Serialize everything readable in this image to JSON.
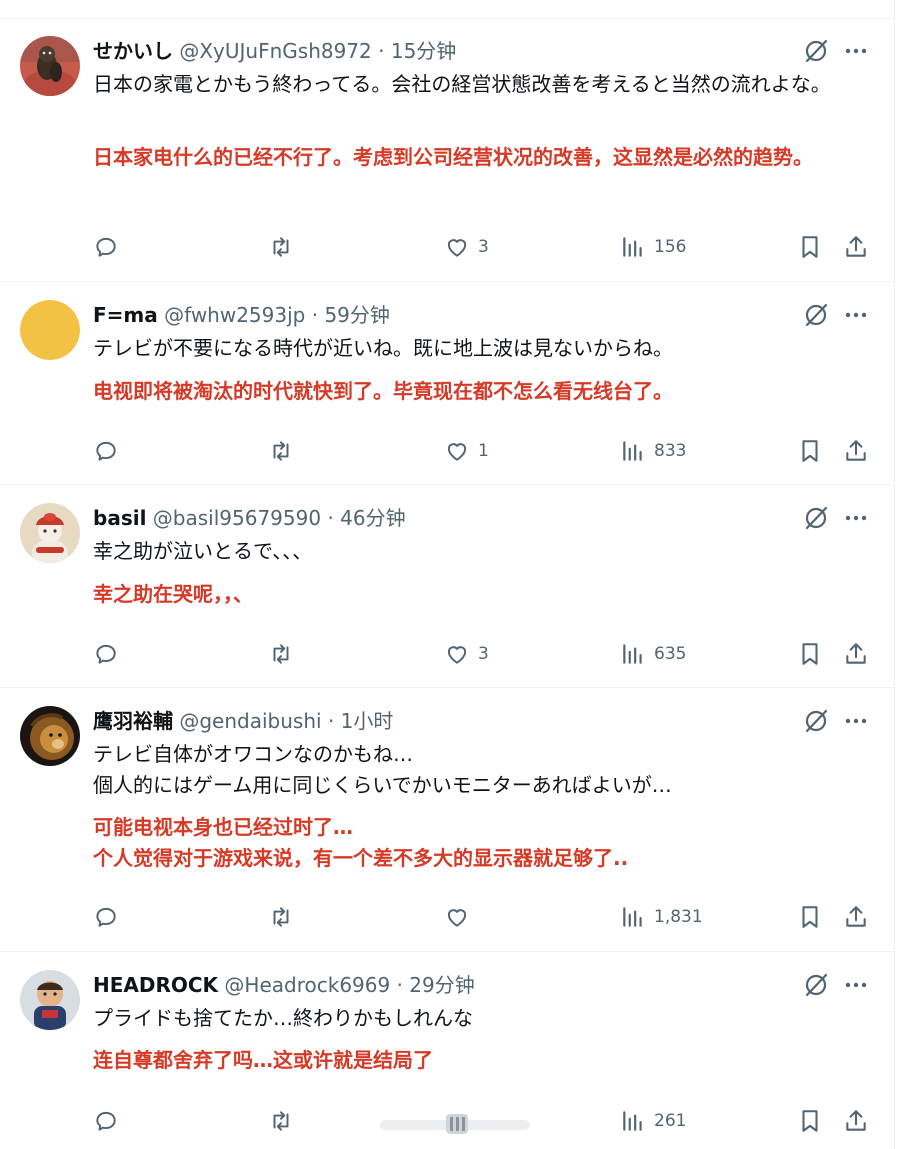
{
  "tweets": [
    {
      "name": "せかいし",
      "handle": "@XyUJuFnGsh8972",
      "time": "15分钟",
      "text_jp": "日本の家電とかもう終わってる。会社の経営状態改善を考えると当然の流れよな。",
      "text_cn": "日本家电什么的已经不行了。考虑到公司经营状况的改善，这显然是必然的趋势。",
      "replies": "",
      "retweets": "",
      "likes": "3",
      "views": "156"
    },
    {
      "name": "F=ma",
      "handle": "@fwhw2593jp",
      "time": "59分钟",
      "text_jp": "テレビが不要になる時代が近いね。既に地上波は見ないからね。",
      "text_cn": "电视即将被淘汰的时代就快到了。毕竟现在都不怎么看无线台了。",
      "replies": "",
      "retweets": "",
      "likes": "1",
      "views": "833"
    },
    {
      "name": "basil",
      "handle": "@basil95679590",
      "time": "46分钟",
      "text_jp": "幸之助が泣いとるで、、、",
      "text_cn": "幸之助在哭呢，，、",
      "replies": "",
      "retweets": "",
      "likes": "3",
      "views": "635"
    },
    {
      "name": "鹰羽裕輔",
      "handle": "@gendaibushi",
      "time": "1小时",
      "text_jp": "テレビ自体がオワコンなのかもね…\n個人的にはゲーム用に同じくらいでかいモニターあればよいが…",
      "text_cn": "可能电视本身也已经过时了…\n个人觉得对于游戏来说，有一个差不多大的显示器就足够了..",
      "replies": "",
      "retweets": "",
      "likes": "",
      "views": "1,831"
    },
    {
      "name": "HEADROCK",
      "handle": "@Headrock6969",
      "time": "29分钟",
      "text_jp": "プライドも捨てたか…終わりかもしれんな",
      "text_cn": "连自尊都舍弃了吗…这或许就是结局了",
      "replies": "",
      "retweets": "",
      "likes": "",
      "views": "261"
    }
  ],
  "header_separator": "·",
  "colors": {
    "translation": "#d63a26",
    "muted": "#536471",
    "text": "#0f1419",
    "divider": "#eff3f4"
  },
  "icons": {
    "reply": "speech-bubble-icon",
    "retweet": "retweet-arrows-icon",
    "like": "heart-icon",
    "views": "bar-chart-icon",
    "bookmark": "bookmark-icon",
    "share": "share-upload-icon",
    "grok": "grok-slash-circle-icon",
    "more": "ellipsis-icon"
  }
}
